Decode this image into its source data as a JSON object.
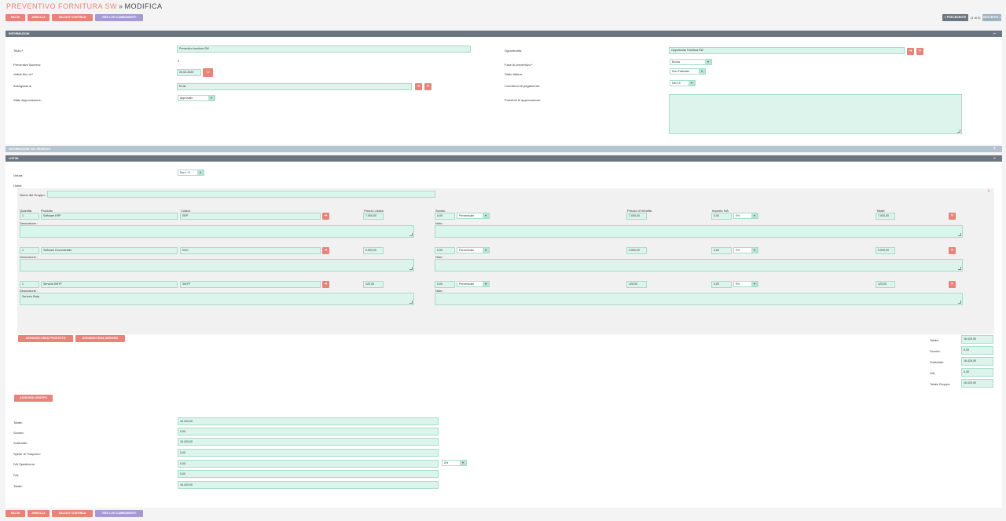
{
  "page": {
    "title": "PREVENTIVO FORNITURA SW",
    "separator": "»",
    "subtitle": "MODIFICA"
  },
  "toolbar": {
    "save": "Salva",
    "cancel": "Annulla",
    "save_continue": "Salva e Continua",
    "view_log": "Vedi Log Cambiamenti"
  },
  "nav": {
    "previous": "< Precedente",
    "counter": "(1 di 2)",
    "next": "Seguente >"
  },
  "panels": {
    "info": "INFORMAZIONI",
    "address": "INFORMAZIONI SUL INDIRIZZO",
    "lists": "LISTINI"
  },
  "info": {
    "title_label": "Titolo:*",
    "title_value": "Preventivo fornitura SW",
    "number_label": "Preventivo Numero:",
    "number_value": "2",
    "valid_label": "Valido fino al:*",
    "valid_value": "20-02-2020",
    "assigned_label": "Assegnato a:",
    "assigned_value": "Ernst",
    "approval_label": "Stato Approvazione:",
    "approval_value": "Approvato",
    "opp_label": "Opportunità:",
    "opp_value": "Opportunità Fornitura SW",
    "stage_label": "Fase di preventivo:*",
    "stage_value": "Bozza",
    "invoice_label": "Stato fattura:",
    "invoice_value": "Non Fatturato",
    "payment_label": "Condizioni di pagamento:",
    "payment_value": "Net 15",
    "issues_label": "Problemi di approvazione:"
  },
  "lists": {
    "currency_label": "Valuta:",
    "currency_value": "Euro : €",
    "lists_label": "Listini:",
    "group_name_label": "Nome del Gruppo:",
    "col_qty": "Quantità",
    "col_product": "Prodotto",
    "col_code": "Codice",
    "col_list_price": "Prezzo Listino",
    "col_discount": "Sconto",
    "col_sale_price": "Prezzo di Vendita",
    "col_vat": "Importo IVA",
    "col_total": "Totale",
    "desc_label": "Descrizione :",
    "note_label": "Note :",
    "rows": [
      {
        "qty": "1",
        "product": "Software ERP",
        "code": "ERP",
        "list_price": "7.000,00",
        "discount": "0,00",
        "discount_type": "Percentuale",
        "sale_price": "7.000,00",
        "vat": "0,00",
        "vat_rate": "0%",
        "total": "7.000,00",
        "description": ""
      },
      {
        "qty": "1",
        "product": "Software Documentale",
        "code": "DOC",
        "list_price": "9.000,00",
        "discount": "0,00",
        "discount_type": "Percentuale",
        "sale_price": "9.000,00",
        "vat": "0,00",
        "vat_rate": "0%",
        "total": "9.000,00",
        "description": ""
      },
      {
        "qty": "1",
        "product": "Servizio SMTP",
        "code": "SMTP",
        "list_price": "120,00",
        "discount": "0,00",
        "discount_type": "Percentuale",
        "sale_price": "120,00",
        "vat": "0,00",
        "vat_rate": "0%",
        "total": "120,00",
        "description": "Servizio Smtp"
      }
    ],
    "add_product": "Aggiungi linea prodotto",
    "add_service": "Aggiungi riga servizio",
    "add_group": "Aggiungi Gruppo",
    "group_totals": [
      {
        "label": "Totale:",
        "value": "16.420,00"
      },
      {
        "label": "Sconto:",
        "value": "0,00"
      },
      {
        "label": "Subtotale:",
        "value": "16.420,00"
      },
      {
        "label": "IVA:",
        "value": "0,00"
      },
      {
        "label": "Totale Gruppo:",
        "value": "16.420,00"
      }
    ],
    "grand_totals": [
      {
        "label": "Totale:",
        "value": "16.420,00"
      },
      {
        "label": "Sconto:",
        "value": "0,00"
      },
      {
        "label": "Subtotale:",
        "value": "16.420,00"
      },
      {
        "label": "Spese di Trasporto:",
        "value": "0,00"
      },
      {
        "label": "IVA Spedizione:",
        "value": "0,00"
      },
      {
        "label": "IVA:",
        "value": "0,00"
      },
      {
        "label": "Totale:",
        "value": "16.420,00"
      }
    ],
    "shipping_vat_rate": "0%"
  },
  "colors": {
    "accent": "#e8837a",
    "header": "#6b7680",
    "field": "#dcf4ec",
    "purple": "#a59bd2"
  }
}
